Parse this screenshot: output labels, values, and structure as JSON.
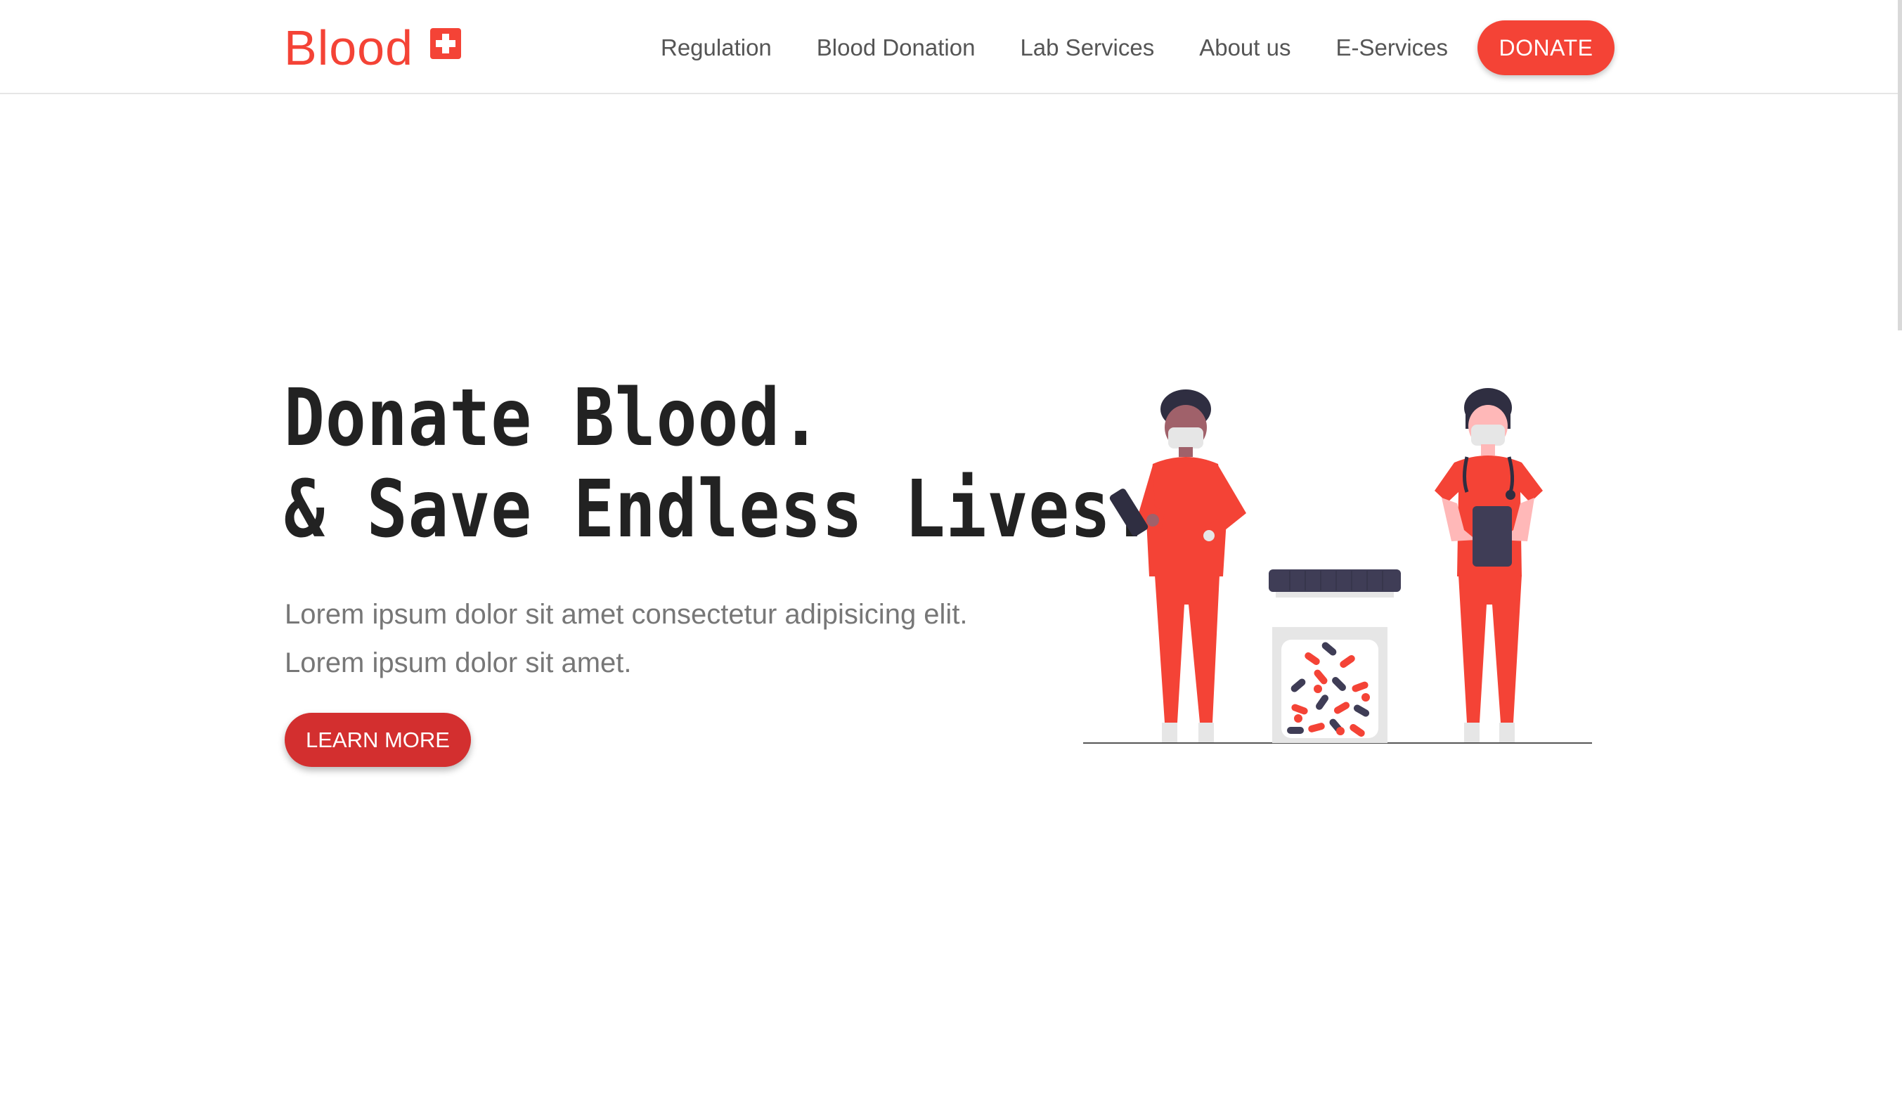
{
  "brand": {
    "name": "Blood",
    "icon": "medical-cross-icon",
    "color": "#f44336"
  },
  "nav": {
    "items": [
      {
        "label": "Regulation"
      },
      {
        "label": "Blood Donation"
      },
      {
        "label": "Lab Services"
      },
      {
        "label": "About us"
      },
      {
        "label": "E-Services"
      }
    ],
    "donate_label": "DONATE"
  },
  "hero": {
    "title_line1": "Donate Blood.",
    "title_line2": "& Save Endless Lives.",
    "subtitle_line1": "Lorem ipsum dolor sit amet consectetur adipisicing elit.",
    "subtitle_line2": "Lorem ipsum dolor sit amet.",
    "cta_label": "LEARN MORE",
    "illustration": "medical-staff-illustration"
  },
  "colors": {
    "accent": "#f44336",
    "cta": "#d32f2f",
    "heading": "#222222",
    "nav_text": "#555555",
    "body_text": "#777777"
  }
}
